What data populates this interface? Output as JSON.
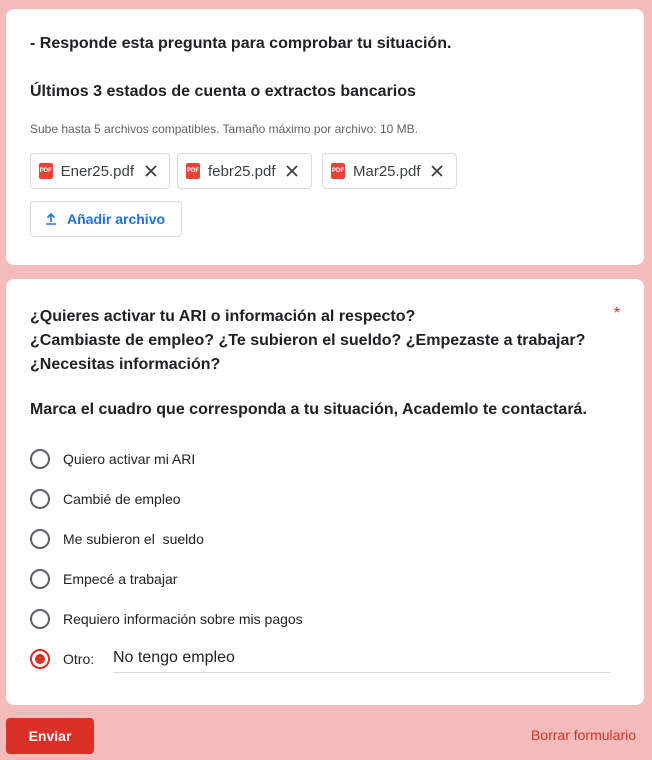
{
  "upload": {
    "intro": "- Responde esta pregunta para comprobar tu situación.",
    "question": "Últimos 3 estados de cuenta o extractos bancarios",
    "hint": "Sube hasta 5 archivos compatibles. Tamaño máximo por archivo: 10 MB.",
    "files": [
      {
        "name": "Ener25.pdf",
        "badge": "PDF"
      },
      {
        "name": "febr25.pdf",
        "badge": "PDF"
      },
      {
        "name": "Mar25.pdf",
        "badge": "PDF"
      }
    ],
    "add_label": "Añadir archivo"
  },
  "question": {
    "line1": "¿Quieres activar tu ARI o información al respecto?",
    "line2": "¿Cambiaste de empleo? ¿Te subieron el sueldo? ¿Empezaste a trabajar?",
    "line3": "¿Necesitas información?",
    "required_mark": "*",
    "instruction": "Marca el cuadro que corresponda a tu situación, Academlo te contactará.",
    "options": [
      {
        "label": "Quiero activar mi ARI",
        "selected": false
      },
      {
        "label": "Cambié de empleo",
        "selected": false
      },
      {
        "label": "Me subieron el  sueldo",
        "selected": false
      },
      {
        "label": "Empecé a trabajar",
        "selected": false
      },
      {
        "label": "Requiero información sobre mis pagos",
        "selected": false
      }
    ],
    "other": {
      "label": "Otro:",
      "value": "No tengo empleo",
      "selected": true
    }
  },
  "footer": {
    "submit_label": "Enviar",
    "clear_label": "Borrar formulario"
  },
  "colors": {
    "background": "#f3bcba",
    "accent": "#d93025",
    "link_blue": "#1a73e8",
    "pdf_red": "#ea4335"
  }
}
